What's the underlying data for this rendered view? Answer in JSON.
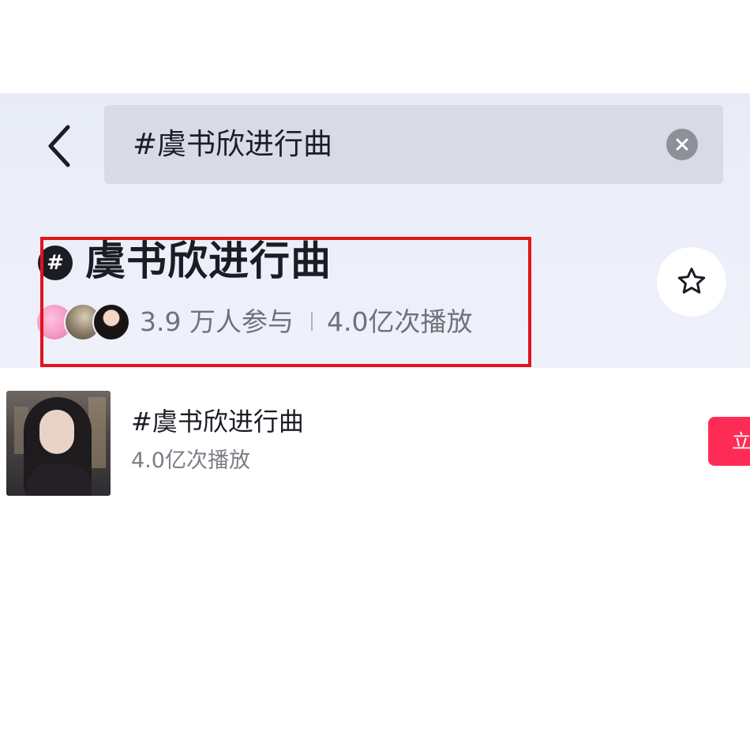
{
  "header": {
    "back_icon": "chevron-left-icon",
    "search": {
      "value": "#虞书欣进行曲",
      "clear_icon": "clear-icon"
    }
  },
  "topic": {
    "hash_symbol": "#",
    "title": "虞书欣进行曲",
    "participants": "3.9 万人参与",
    "plays": "4.0亿次播放",
    "favorite_icon": "star-icon"
  },
  "results": [
    {
      "title": "#虞书欣进行曲",
      "plays": "4.0亿次播放",
      "action_label": "立"
    }
  ],
  "colors": {
    "highlight": "#e3121b",
    "accent": "#fe2c55",
    "header_bg": "#eceff9"
  }
}
